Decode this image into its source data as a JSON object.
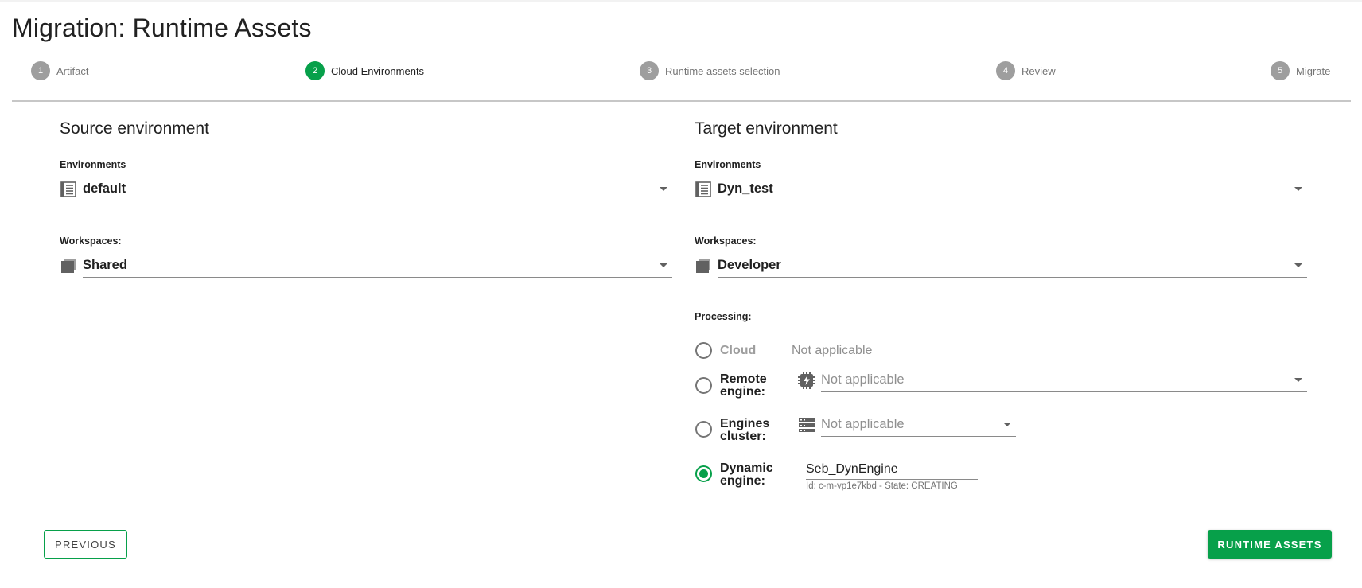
{
  "page": {
    "title_prefix": "Migration:",
    "title_rest": " Runtime Assets"
  },
  "stepper": {
    "steps": [
      {
        "number": "1",
        "label": "Artifact",
        "active": false
      },
      {
        "number": "2",
        "label": "Cloud Environments",
        "active": true
      },
      {
        "number": "3",
        "label": "Runtime assets selection",
        "active": false
      },
      {
        "number": "4",
        "label": "Review",
        "active": false
      },
      {
        "number": "5",
        "label": "Migrate",
        "active": false
      }
    ]
  },
  "source": {
    "title": "Source environment",
    "environments_label": "Environments",
    "environment_value": "default",
    "workspaces_label": "Workspaces:",
    "workspace_value": "Shared"
  },
  "target": {
    "title": "Target environment",
    "environments_label": "Environments",
    "environment_value": "Dyn_test",
    "workspaces_label": "Workspaces:",
    "workspace_value": "Developer",
    "processing_label": "Processing:",
    "processing": {
      "cloud": {
        "label": "Cloud",
        "value": "Not applicable"
      },
      "remote_engine": {
        "label_line1": "Remote",
        "label_line2": "engine:",
        "value": "Not applicable"
      },
      "engines_cluster": {
        "label_line1": "Engines",
        "label_line2": "cluster:",
        "value": "Not applicable"
      },
      "dynamic_engine": {
        "label_line1": "Dynamic",
        "label_line2": "engine:",
        "value": "Seb_DynEngine",
        "hint": "Id: c-m-vp1e7kbd - State: CREATING"
      },
      "selected": "dynamic_engine"
    }
  },
  "actions": {
    "previous_label": "PREVIOUS",
    "next_label": "RUNTIME ASSETS"
  },
  "colors": {
    "accent": "#07a04a",
    "step_inactive": "#9e9e9e"
  }
}
